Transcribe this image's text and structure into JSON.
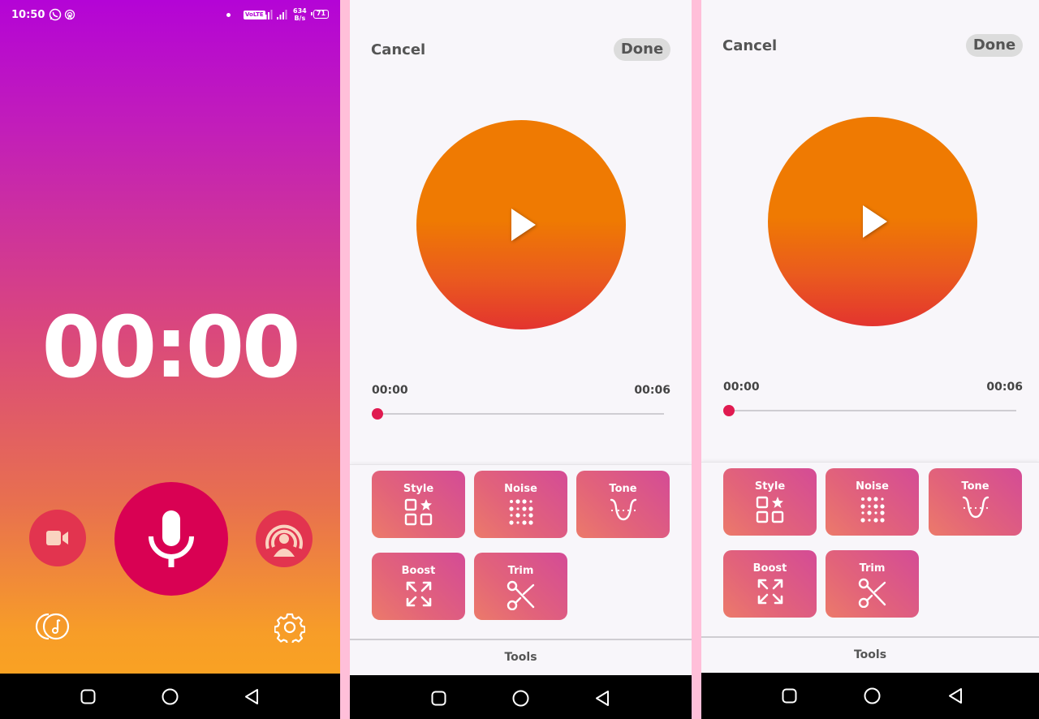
{
  "status_bar": {
    "time": "10:50",
    "volte": "VoLTE",
    "net_speed_value": "634",
    "net_speed_unit": "B/s",
    "battery": "71"
  },
  "recorder": {
    "timer": "00:00",
    "colors": {
      "mic_button": "#d90153",
      "side_buttons": "#e2344f"
    },
    "icons": [
      "video-camera-icon",
      "microphone-icon",
      "live-broadcast-icon",
      "music-library-icon",
      "gear-icon"
    ]
  },
  "editors": [
    {
      "cancel_label": "Cancel",
      "done_label": "Done",
      "time_start": "00:00",
      "time_end": "00:06",
      "progress": 0,
      "tools": [
        {
          "label": "Style",
          "icon": "style-grid-star-icon"
        },
        {
          "label": "Noise",
          "icon": "noise-dots-icon"
        },
        {
          "label": "Tone",
          "icon": "tone-curve-icon"
        },
        {
          "label": "Boost",
          "icon": "boost-expand-icon"
        },
        {
          "label": "Trim",
          "icon": "scissors-icon"
        }
      ],
      "bottom_tab": "Tools"
    },
    {
      "cancel_label": "Cancel",
      "done_label": "Done",
      "time_start": "00:00",
      "time_end": "00:06",
      "progress": 0,
      "tools": [
        {
          "label": "Style",
          "icon": "style-grid-star-icon"
        },
        {
          "label": "Noise",
          "icon": "noise-dots-icon"
        },
        {
          "label": "Tone",
          "icon": "tone-curve-icon"
        },
        {
          "label": "Boost",
          "icon": "boost-expand-icon"
        },
        {
          "label": "Trim",
          "icon": "scissors-icon"
        }
      ],
      "bottom_tab": "Tools"
    }
  ],
  "navigation": [
    "recents",
    "home",
    "back"
  ]
}
